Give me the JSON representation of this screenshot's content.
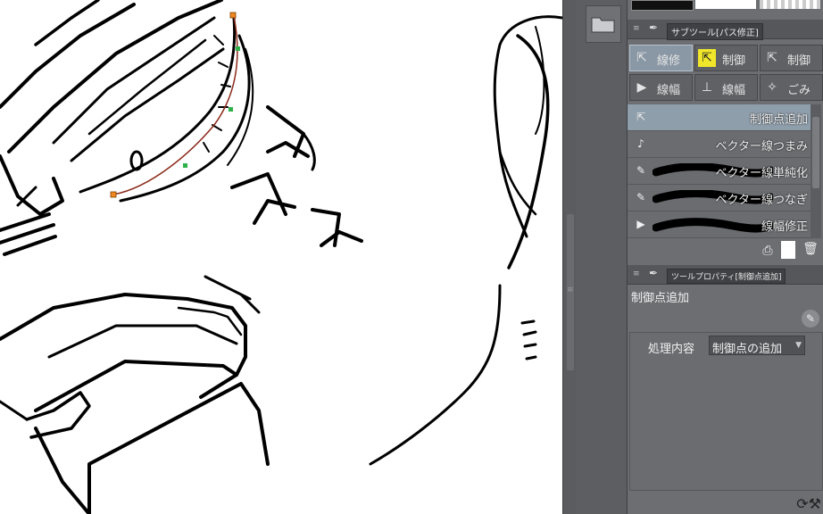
{
  "canvas": {
    "description_label": "",
    "line_color": "#000000",
    "path_color": "#8b2a1a",
    "handle_color": "#f08a20",
    "point_color": "#2fb24a"
  },
  "dock": {
    "folder_icon": "folder-icon"
  },
  "subtool_panel": {
    "header_title": "サブツール[パス修正]",
    "group_buttons": [
      {
        "label": "線修",
        "icon": "line-edit-icon",
        "selected": true
      },
      {
        "label": "制御",
        "icon": "control-point-icon",
        "selected": false,
        "highlight": true
      },
      {
        "label": "制御",
        "icon": "control-point-icon",
        "selected": false
      },
      {
        "label": "線幅",
        "icon": "line-width-icon",
        "selected": false
      },
      {
        "label": "線幅",
        "icon": "line-width-icon",
        "selected": false
      },
      {
        "label": "ごみ",
        "icon": "dust-icon",
        "selected": false
      }
    ],
    "tools": [
      {
        "label": "制御点追加",
        "icon": "arrow-icon",
        "selected": true
      },
      {
        "label": "ベクター線つまみ",
        "icon": "pinch-icon",
        "selected": false
      },
      {
        "label": "ベクター線単純化",
        "icon": "brush-icon",
        "selected": false
      },
      {
        "label": "ベクター線つなぎ",
        "icon": "brush-icon",
        "selected": false
      },
      {
        "label": "線幅修正",
        "icon": "width-icon",
        "selected": false
      }
    ],
    "footer_icons": [
      "tool-settings-icon",
      "new-sheet-icon",
      "trash-icon"
    ]
  },
  "tool_property": {
    "header_title": "ツールプロパティ[制御点追加]",
    "tool_name": "制御点追加",
    "process_label": "処理内容",
    "process_value": "制御点の追加"
  },
  "colors": {
    "panel_bg": "#6c6e72",
    "selected_bg": "#8f9eab",
    "highlight": "#f0e62a"
  }
}
